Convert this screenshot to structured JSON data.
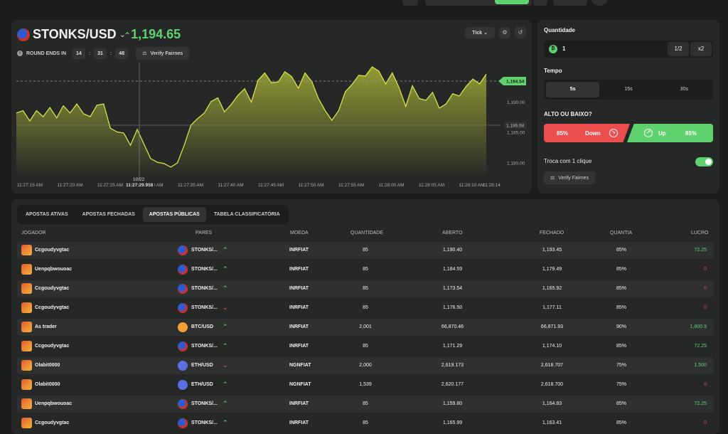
{
  "chart": {
    "pair": "STONKS/USD",
    "price": "1,194.65",
    "round_label": "ROUND ENDS IN",
    "countdown": [
      "14",
      "31",
      "48"
    ],
    "verify_label": "Verify Fairnes",
    "tick_label": "Tick",
    "current_price_tag": "1,194.54",
    "crosshair_price": "1,186.68",
    "crosshair_time": "11:27:29.958",
    "crosshair_date": "10/22"
  },
  "chart_data": {
    "type": "area",
    "x": [
      "11:27:15 AM",
      "11:27:20 AM",
      "11:27:25 AM",
      "11:27:30 AM",
      "11:27:35 AM",
      "11:27:40 AM",
      "11:27:45 AM",
      "11:27:50 AM",
      "11:27:55 AM",
      "11:28:00 AM",
      "11:28:05 AM",
      "11:28:10 AM",
      "11:28:14"
    ],
    "y_ticks": [
      "1,190.00",
      "1,185.00",
      "1,180.00"
    ],
    "ylim": [
      1178,
      1196.5
    ],
    "series": [
      {
        "values": [
          1188.2,
          1188.6,
          1186.9,
          1188.6,
          1187.6,
          1189.1,
          1187.4,
          1189.4,
          1188.2,
          1189.7,
          1188.1,
          1187.6,
          1189.5,
          1189.7,
          1185.7,
          1185.1,
          1184.9,
          1182.9,
          1185.5,
          1183.1,
          1180.7,
          1180.1,
          1179.9,
          1179.3,
          1180.0,
          1182.9,
          1186.2,
          1187.3,
          1188.2,
          1190.1,
          1190.7,
          1188.4,
          1189.6,
          1191.1,
          1192.2,
          1190.0,
          1193.6,
          1194.8,
          1193.2,
          1193.3,
          1195.0,
          1194.2,
          1192.3,
          1194.8,
          1193.4,
          1190.6,
          1188.6,
          1187.0,
          1188.6,
          1191.7,
          1192.9,
          1194.4,
          1194.3,
          1195.8,
          1195.1,
          1193.0,
          1194.8,
          1192.4,
          1189.3,
          1192.7,
          1190.6,
          1190.3,
          1191.6,
          1189.0,
          1189.7,
          1191.4,
          1191.0,
          1192.6,
          1193.8,
          1193.0,
          1194.6
        ]
      }
    ],
    "grid": false
  },
  "side": {
    "quantity_label": "Quantidade",
    "quantity_value": "1",
    "half_label": "1/2",
    "double_label": "x2",
    "time_label": "Tempo",
    "time_options": [
      "5s",
      "15s",
      "30s"
    ],
    "direction_label": "ALTO OU BAIXO?",
    "down_pct": "85%",
    "down_label": "Down",
    "up_label": "Up",
    "up_pct": "85%",
    "oneclick_label": "Troca com 1 clique",
    "verify_label": "Verify Fairnes"
  },
  "bets": {
    "tabs": [
      "APOSTAS ATIVAS",
      "APOSTAS FECHADAS",
      "APOSTAS PÚBLICAS",
      "TABELA CLASSIFICATÓRIA"
    ],
    "columns": [
      "JOGADOR",
      "PARES",
      "MOEDA",
      "QUANTIDADE",
      "ABERTO",
      "FECHADO",
      "QUANTIA",
      "LUCRO"
    ],
    "rows": [
      {
        "player": "Ccgoudyvgtac",
        "pair": "STONKS/...",
        "dir": "up",
        "moeda": "INRFIAT",
        "qty": "85",
        "open": "1,190.40",
        "close": "1,193.45",
        "pct": "85%",
        "profit": "72.25"
      },
      {
        "player": "Uenpqbwouoac",
        "pair": "STONKS/...",
        "dir": "up",
        "moeda": "INRFIAT",
        "qty": "85",
        "open": "1,184.59",
        "close": "1,179.49",
        "pct": "85%",
        "profit": "0"
      },
      {
        "player": "Ccgoudyvgtac",
        "pair": "STONKS/...",
        "dir": "up",
        "moeda": "INRFIAT",
        "qty": "85",
        "open": "1,173.54",
        "close": "1,165.92",
        "pct": "85%",
        "profit": "0"
      },
      {
        "player": "Ccgoudyvgtac",
        "pair": "STONKS/...",
        "dir": "down",
        "moeda": "INRFIAT",
        "qty": "85",
        "open": "1,176.50",
        "close": "1,177.11",
        "pct": "85%",
        "profit": "0"
      },
      {
        "player": "As trader",
        "pair": "BTC/USD",
        "dir": "up",
        "moeda": "INRFIAT",
        "qty": "2,001",
        "open": "66,870.46",
        "close": "66,871.93",
        "pct": "90%",
        "profit": "1,800.9"
      },
      {
        "player": "Ccgoudyvgtac",
        "pair": "STONKS/...",
        "dir": "up",
        "moeda": "INRFIAT",
        "qty": "85",
        "open": "1,171.29",
        "close": "1,174.10",
        "pct": "85%",
        "profit": "72.25"
      },
      {
        "player": "Olabit0000",
        "pair": "ETH/USD",
        "dir": "down",
        "moeda": "NGNFIAT",
        "qty": "2,000",
        "open": "2,619.173",
        "close": "2,618.707",
        "pct": "75%",
        "profit": "1,500"
      },
      {
        "player": "Olabit0000",
        "pair": "ETH/USD",
        "dir": "up",
        "moeda": "NGNFIAT",
        "qty": "1,539",
        "open": "2,620.177",
        "close": "2,618.700",
        "pct": "75%",
        "profit": "0"
      },
      {
        "player": "Uenpqbwouoac",
        "pair": "STONKS/...",
        "dir": "up",
        "moeda": "INRFIAT",
        "qty": "85",
        "open": "1,159.80",
        "close": "1,164.83",
        "pct": "85%",
        "profit": "72.25"
      },
      {
        "player": "Ccgoudyvgtac",
        "pair": "STONKS/...",
        "dir": "up",
        "moeda": "INRFIAT",
        "qty": "85",
        "open": "1,165.99",
        "close": "1,163.41",
        "pct": "85%",
        "profit": "0"
      }
    ]
  },
  "colors": {
    "up": "#5fd16f",
    "down": "#ec4d4d",
    "accent_area": "#b8c23a"
  }
}
